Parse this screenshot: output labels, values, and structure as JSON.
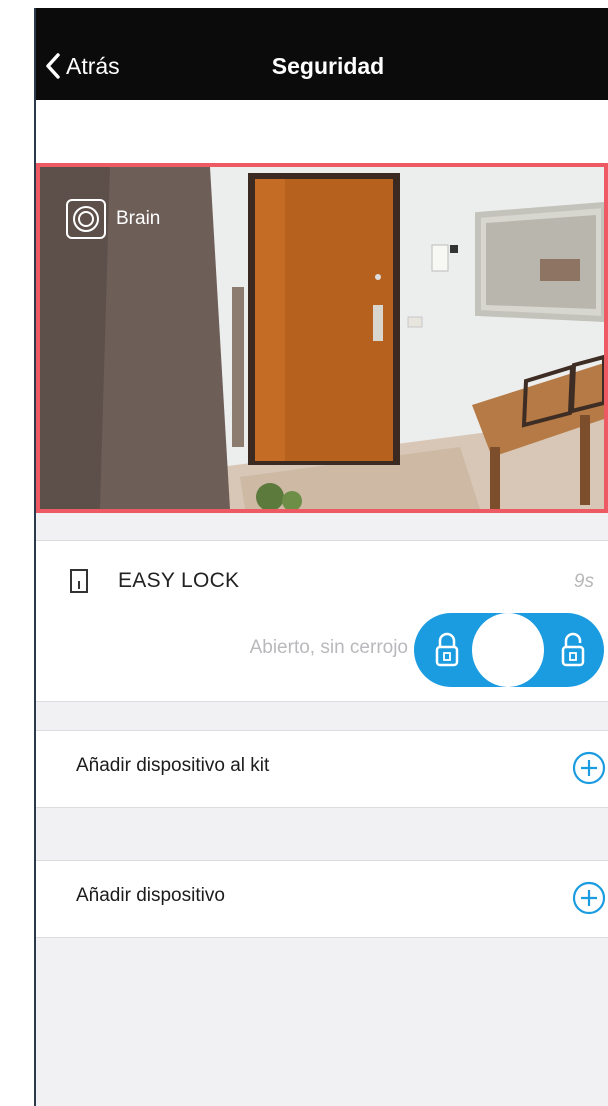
{
  "nav": {
    "back_label": "Atrás",
    "title": "Seguridad"
  },
  "camera": {
    "label": "Brain"
  },
  "lock": {
    "name": "EASY LOCK",
    "time": "9s",
    "status": "Abierto, sin cerrojo"
  },
  "rows": [
    {
      "label": "Añadir dispositivo al kit"
    },
    {
      "label": "Añadir dispositivo"
    }
  ],
  "colors": {
    "accent": "#1b9ce0",
    "highlight_border": "#ee5a63",
    "navbar": "#0b0b0b"
  },
  "icons": [
    "chevron-left-icon",
    "brain-logo-icon",
    "door-icon",
    "padlock-closed-icon",
    "padlock-open-icon",
    "plus-circle-icon"
  ]
}
